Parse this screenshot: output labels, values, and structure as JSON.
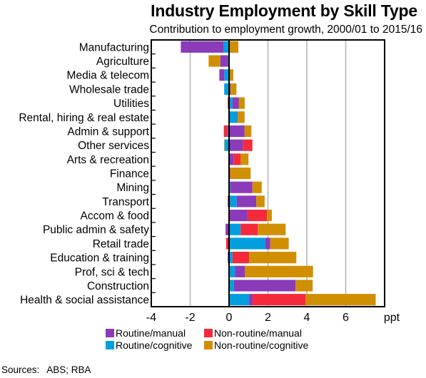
{
  "chart_data": {
    "type": "bar",
    "orientation": "horizontal",
    "stacked": true,
    "title": "Industry Employment by Skill Type",
    "subtitle": "Contribution to employment growth, 2000/01 to 2015/16",
    "xlabel": "ppt",
    "ylabel": "",
    "xlim": [
      -4,
      8
    ],
    "xticks": [
      -4,
      -2,
      0,
      2,
      4,
      6
    ],
    "xtick_labels": [
      "-4",
      "-2",
      "0",
      "2",
      "4",
      "6"
    ],
    "grid": "vertical",
    "legend_position": "bottom",
    "categories": [
      "Manufacturing",
      "Agriculture",
      "Media & telecom",
      "Wholesale trade",
      "Utilities",
      "Rental, hiring & real estate",
      "Admin & support",
      "Other services",
      "Arts & recreation",
      "Finance",
      "Mining",
      "Transport",
      "Accom & food",
      "Public admin & safety",
      "Retail trade",
      "Education & training",
      "Prof, sci & tech",
      "Construction",
      "Health & social assistance"
    ],
    "series": [
      {
        "name": "Routine/cognitive",
        "color": "#009fdf",
        "values": [
          -0.28,
          -0.05,
          -0.25,
          -0.25,
          0.18,
          0.42,
          -0.07,
          -0.22,
          0.03,
          0.04,
          0.07,
          0.4,
          0.0,
          0.6,
          1.87,
          0.18,
          0.3,
          0.25,
          1.03
        ]
      },
      {
        "name": "Routine/manual",
        "color": "#8b3ab9",
        "values": [
          -2.2,
          -0.4,
          -0.25,
          0.08,
          0.33,
          0.03,
          0.8,
          0.72,
          0.2,
          0.0,
          1.13,
          1.0,
          0.95,
          -0.18,
          0.25,
          -0.07,
          0.52,
          3.17,
          0.18
        ]
      },
      {
        "name": "Non-routine/manual",
        "color": "#f42a3c",
        "values": [
          0.03,
          0.0,
          0.0,
          0.0,
          -0.07,
          0.0,
          -0.2,
          0.48,
          0.37,
          0.04,
          0.0,
          -0.07,
          1.0,
          0.88,
          -0.15,
          0.85,
          -0.03,
          0.0,
          2.73
        ]
      },
      {
        "name": "Non-routine/cognitive",
        "color": "#d08f00",
        "values": [
          0.45,
          -0.6,
          0.22,
          0.3,
          0.3,
          0.35,
          0.35,
          -0.03,
          0.4,
          1.03,
          0.48,
          0.43,
          0.25,
          1.43,
          0.95,
          2.43,
          3.5,
          0.88,
          3.6
        ]
      }
    ],
    "legend": [
      {
        "label": "Routine/manual",
        "color": "#8b3ab9"
      },
      {
        "label": "Non-routine/manual",
        "color": "#f42a3c"
      },
      {
        "label": "Routine/cognitive",
        "color": "#009fdf"
      },
      {
        "label": "Non-routine/cognitive",
        "color": "#d08f00"
      }
    ],
    "source": {
      "label": "Sources:",
      "text": "ABS; RBA"
    }
  }
}
